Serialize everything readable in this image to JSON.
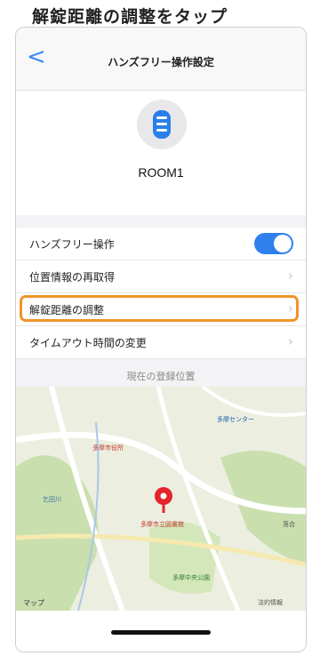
{
  "caption": "解錠距離の調整をタップ",
  "nav": {
    "back_label": "<",
    "title": "ハンズフリー操作設定"
  },
  "device": {
    "name": "ROOM1"
  },
  "settings": [
    {
      "label": "ハンズフリー操作",
      "control": "toggle",
      "on": true
    },
    {
      "label": "位置情報の再取得",
      "control": "chevron"
    },
    {
      "label": "解錠距離の調整",
      "control": "chevron",
      "highlighted": true
    },
    {
      "label": "タイムアウト時間の変更",
      "control": "chevron"
    }
  ],
  "section_title": "現在の登録位置",
  "map": {
    "labels": [
      "多摩市役所",
      "多摩中央公園",
      "多摩市立図書館",
      "多摩センター",
      "乞田川",
      "落合"
    ],
    "attribution": "マップ",
    "legal": "法的情報"
  },
  "colors": {
    "accent": "#2f80ed",
    "highlight": "#f0932b",
    "pin": "#e5242b"
  },
  "icons": {
    "back": "chevron-left-icon",
    "device": "smart-lock-icon",
    "row": "chevron-right-icon",
    "pin": "map-pin-icon"
  }
}
